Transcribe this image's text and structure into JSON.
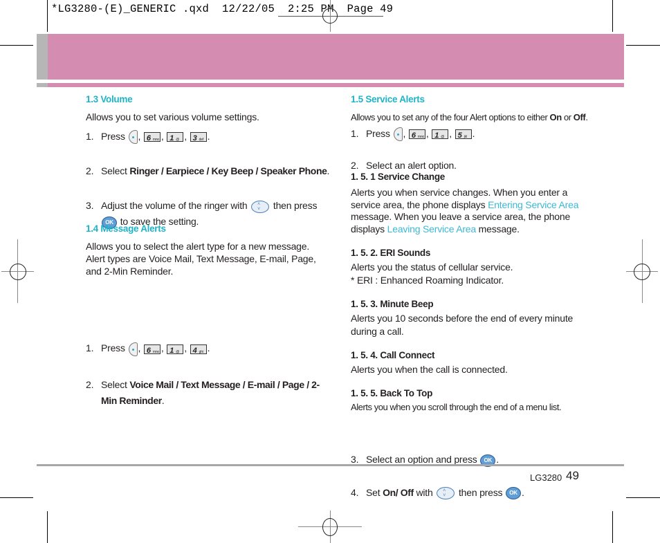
{
  "slug": {
    "text": "*LG3280-(E)_GENERIC .qxd  12/22/05  2:25 PM  Page 49"
  },
  "colors": {
    "header_band": "#d48db1",
    "header_tab": "#b6b6b6",
    "section_title": "#1eb4c8",
    "highlight_text": "#3cb8d4",
    "footer_rule": "#a7a7a7"
  },
  "icons": {
    "soft_key": "left-soft-key-icon",
    "key_6": {
      "num": "6",
      "sub": "mno"
    },
    "key_1": {
      "num": "1",
      "sub": "@"
    },
    "key_3": {
      "num": "3",
      "sub": "def"
    },
    "key_4": {
      "num": "4",
      "sub": "ghi"
    },
    "key_5": {
      "num": "5",
      "sub": "jkl"
    },
    "ok": "OK",
    "nav_up": "˄",
    "nav_down": "˅"
  },
  "volume": {
    "title": "1.3 Volume",
    "intro": "Allows you to set various volume settings.",
    "step1_num": "1.",
    "step1_label": "Press",
    "step2_num": "2.",
    "step2_pre": "Select ",
    "step2_bold": "Ringer / Earpiece / Key Beep / Speaker Phone",
    "step2_post": ".",
    "step3_num": "3.",
    "step3_pre": "Adjust the volume of the ringer with",
    "step3_mid": "then press",
    "step3_post": "to save the setting."
  },
  "message_alerts": {
    "title": "1.4 Message Alerts",
    "intro_lines": [
      "Allows you to select the alert type for a new message.",
      "Alert types are Voice Mail, Text Message, E-mail, Page,",
      "and 2-Min Reminder."
    ],
    "step1_num": "1.",
    "step1_label": "Press",
    "step2_num": "2.",
    "step2_pre": "Select ",
    "step2_bold_line1": "Voice Mail / Text Message / E-mail / Page / 2-",
    "step2_bold_line2": "Min Reminder",
    "step2_post": "."
  },
  "service_alerts": {
    "title": "1.5 Service Alerts",
    "intro_pre": "Allows you to set any of the four Alert options to either ",
    "intro_on": "On",
    "intro_or": " or ",
    "intro_off": "Off",
    "intro_end": ".",
    "step1_num": "1.",
    "step1_label": "Press",
    "step2_num": "2.",
    "step2_text": "Select an alert option.",
    "subsections": {
      "service_change": {
        "title": "1. 5. 1 Service Change",
        "line1": "Alerts you when service changes. When you enter a",
        "line2_pre": "service area, the phone displays ",
        "line2_hl": "Entering Service Area",
        "line3": "message. When you leave a service area, the phone",
        "line4_pre": "displays ",
        "line4_hl": "Leaving Service Area",
        "line4_post": " message."
      },
      "eri_sounds": {
        "title": "1. 5. 2. ERI Sounds",
        "line1": "Alerts you the status of cellular service.",
        "line2": "* ERI : Enhanced Roaming Indicator."
      },
      "minute_beep": {
        "title": "1. 5. 3. Minute Beep",
        "line1": "Alerts you 10 seconds before the end of every minute",
        "line2": "during a call."
      },
      "call_connect": {
        "title": "1. 5. 4. Call Connect",
        "line1": "Alerts you when the call is connected."
      },
      "back_to_top": {
        "title": "1. 5. 5. Back To Top",
        "line1": "Alerts you when you scroll through the end of a menu list."
      }
    },
    "step3_num": "3.",
    "step3_text": "Select an option and press",
    "step3_post": ".",
    "step4_num": "4.",
    "step4_pre": "Set ",
    "step4_bold": "On/ Off",
    "step4_mid": " with",
    "step4_mid2": "then press",
    "step4_post": "."
  },
  "footer": {
    "model": "LG3280",
    "page_number": "49"
  }
}
